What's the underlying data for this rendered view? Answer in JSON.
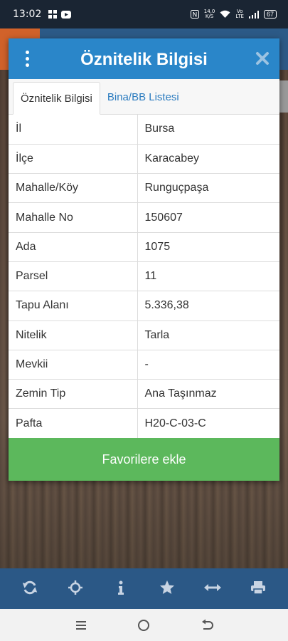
{
  "status_bar": {
    "time": "13:02",
    "speed_value": "14,0",
    "speed_unit": "K/S",
    "network_label_top": "Vo",
    "network_label_bottom": "LTE",
    "battery": "67"
  },
  "dialog": {
    "title": "Öznitelik Bilgisi",
    "tabs": [
      {
        "label": "Öznitelik Bilgisi",
        "active": true
      },
      {
        "label": "Bina/BB Listesi",
        "active": false
      }
    ],
    "rows": [
      {
        "key": "İl",
        "value": "Bursa"
      },
      {
        "key": "İlçe",
        "value": "Karacabey"
      },
      {
        "key": "Mahalle/Köy",
        "value": "Runguçpaşa"
      },
      {
        "key": "Mahalle No",
        "value": "150607"
      },
      {
        "key": "Ada",
        "value": "1075"
      },
      {
        "key": "Parsel",
        "value": "11"
      },
      {
        "key": "Tapu Alanı",
        "value": "5.336,38"
      },
      {
        "key": "Nitelik",
        "value": "Tarla"
      },
      {
        "key": "Mevkii",
        "value": "-"
      },
      {
        "key": "Zemin Tip",
        "value": "Ana Taşınmaz"
      },
      {
        "key": "Pafta",
        "value": "H20-C-03-C"
      }
    ],
    "favorite_button": "Favorilere ekle"
  },
  "toolbar": {
    "items": [
      {
        "icon": "refresh-icon"
      },
      {
        "icon": "crosshair-icon"
      },
      {
        "icon": "info-icon"
      },
      {
        "icon": "star-icon"
      },
      {
        "icon": "measure-icon"
      },
      {
        "icon": "print-icon"
      }
    ]
  },
  "colors": {
    "header_blue": "#2a86c9",
    "toolbar_blue": "#2b5886",
    "favorite_green": "#5cb85c",
    "tab_link": "#2a7bbf"
  }
}
